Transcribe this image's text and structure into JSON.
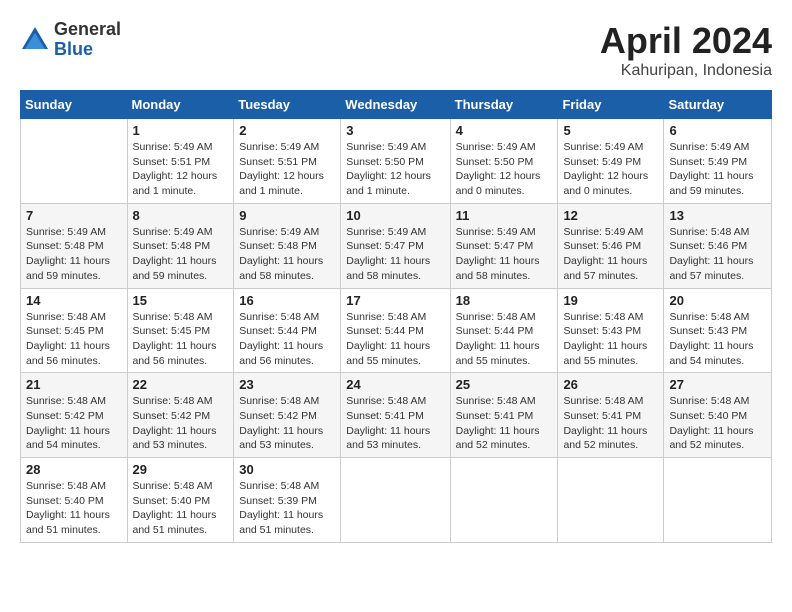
{
  "header": {
    "logo_general": "General",
    "logo_blue": "Blue",
    "title": "April 2024",
    "location": "Kahuripan, Indonesia"
  },
  "days_of_week": [
    "Sunday",
    "Monday",
    "Tuesday",
    "Wednesday",
    "Thursday",
    "Friday",
    "Saturday"
  ],
  "weeks": [
    [
      {
        "day": "",
        "detail": ""
      },
      {
        "day": "1",
        "detail": "Sunrise: 5:49 AM\nSunset: 5:51 PM\nDaylight: 12 hours\nand 1 minute."
      },
      {
        "day": "2",
        "detail": "Sunrise: 5:49 AM\nSunset: 5:51 PM\nDaylight: 12 hours\nand 1 minute."
      },
      {
        "day": "3",
        "detail": "Sunrise: 5:49 AM\nSunset: 5:50 PM\nDaylight: 12 hours\nand 1 minute."
      },
      {
        "day": "4",
        "detail": "Sunrise: 5:49 AM\nSunset: 5:50 PM\nDaylight: 12 hours\nand 0 minutes."
      },
      {
        "day": "5",
        "detail": "Sunrise: 5:49 AM\nSunset: 5:49 PM\nDaylight: 12 hours\nand 0 minutes."
      },
      {
        "day": "6",
        "detail": "Sunrise: 5:49 AM\nSunset: 5:49 PM\nDaylight: 11 hours\nand 59 minutes."
      }
    ],
    [
      {
        "day": "7",
        "detail": "Sunrise: 5:49 AM\nSunset: 5:48 PM\nDaylight: 11 hours\nand 59 minutes."
      },
      {
        "day": "8",
        "detail": "Sunrise: 5:49 AM\nSunset: 5:48 PM\nDaylight: 11 hours\nand 59 minutes."
      },
      {
        "day": "9",
        "detail": "Sunrise: 5:49 AM\nSunset: 5:48 PM\nDaylight: 11 hours\nand 58 minutes."
      },
      {
        "day": "10",
        "detail": "Sunrise: 5:49 AM\nSunset: 5:47 PM\nDaylight: 11 hours\nand 58 minutes."
      },
      {
        "day": "11",
        "detail": "Sunrise: 5:49 AM\nSunset: 5:47 PM\nDaylight: 11 hours\nand 58 minutes."
      },
      {
        "day": "12",
        "detail": "Sunrise: 5:49 AM\nSunset: 5:46 PM\nDaylight: 11 hours\nand 57 minutes."
      },
      {
        "day": "13",
        "detail": "Sunrise: 5:48 AM\nSunset: 5:46 PM\nDaylight: 11 hours\nand 57 minutes."
      }
    ],
    [
      {
        "day": "14",
        "detail": "Sunrise: 5:48 AM\nSunset: 5:45 PM\nDaylight: 11 hours\nand 56 minutes."
      },
      {
        "day": "15",
        "detail": "Sunrise: 5:48 AM\nSunset: 5:45 PM\nDaylight: 11 hours\nand 56 minutes."
      },
      {
        "day": "16",
        "detail": "Sunrise: 5:48 AM\nSunset: 5:44 PM\nDaylight: 11 hours\nand 56 minutes."
      },
      {
        "day": "17",
        "detail": "Sunrise: 5:48 AM\nSunset: 5:44 PM\nDaylight: 11 hours\nand 55 minutes."
      },
      {
        "day": "18",
        "detail": "Sunrise: 5:48 AM\nSunset: 5:44 PM\nDaylight: 11 hours\nand 55 minutes."
      },
      {
        "day": "19",
        "detail": "Sunrise: 5:48 AM\nSunset: 5:43 PM\nDaylight: 11 hours\nand 55 minutes."
      },
      {
        "day": "20",
        "detail": "Sunrise: 5:48 AM\nSunset: 5:43 PM\nDaylight: 11 hours\nand 54 minutes."
      }
    ],
    [
      {
        "day": "21",
        "detail": "Sunrise: 5:48 AM\nSunset: 5:42 PM\nDaylight: 11 hours\nand 54 minutes."
      },
      {
        "day": "22",
        "detail": "Sunrise: 5:48 AM\nSunset: 5:42 PM\nDaylight: 11 hours\nand 53 minutes."
      },
      {
        "day": "23",
        "detail": "Sunrise: 5:48 AM\nSunset: 5:42 PM\nDaylight: 11 hours\nand 53 minutes."
      },
      {
        "day": "24",
        "detail": "Sunrise: 5:48 AM\nSunset: 5:41 PM\nDaylight: 11 hours\nand 53 minutes."
      },
      {
        "day": "25",
        "detail": "Sunrise: 5:48 AM\nSunset: 5:41 PM\nDaylight: 11 hours\nand 52 minutes."
      },
      {
        "day": "26",
        "detail": "Sunrise: 5:48 AM\nSunset: 5:41 PM\nDaylight: 11 hours\nand 52 minutes."
      },
      {
        "day": "27",
        "detail": "Sunrise: 5:48 AM\nSunset: 5:40 PM\nDaylight: 11 hours\nand 52 minutes."
      }
    ],
    [
      {
        "day": "28",
        "detail": "Sunrise: 5:48 AM\nSunset: 5:40 PM\nDaylight: 11 hours\nand 51 minutes."
      },
      {
        "day": "29",
        "detail": "Sunrise: 5:48 AM\nSunset: 5:40 PM\nDaylight: 11 hours\nand 51 minutes."
      },
      {
        "day": "30",
        "detail": "Sunrise: 5:48 AM\nSunset: 5:39 PM\nDaylight: 11 hours\nand 51 minutes."
      },
      {
        "day": "",
        "detail": ""
      },
      {
        "day": "",
        "detail": ""
      },
      {
        "day": "",
        "detail": ""
      },
      {
        "day": "",
        "detail": ""
      }
    ]
  ]
}
